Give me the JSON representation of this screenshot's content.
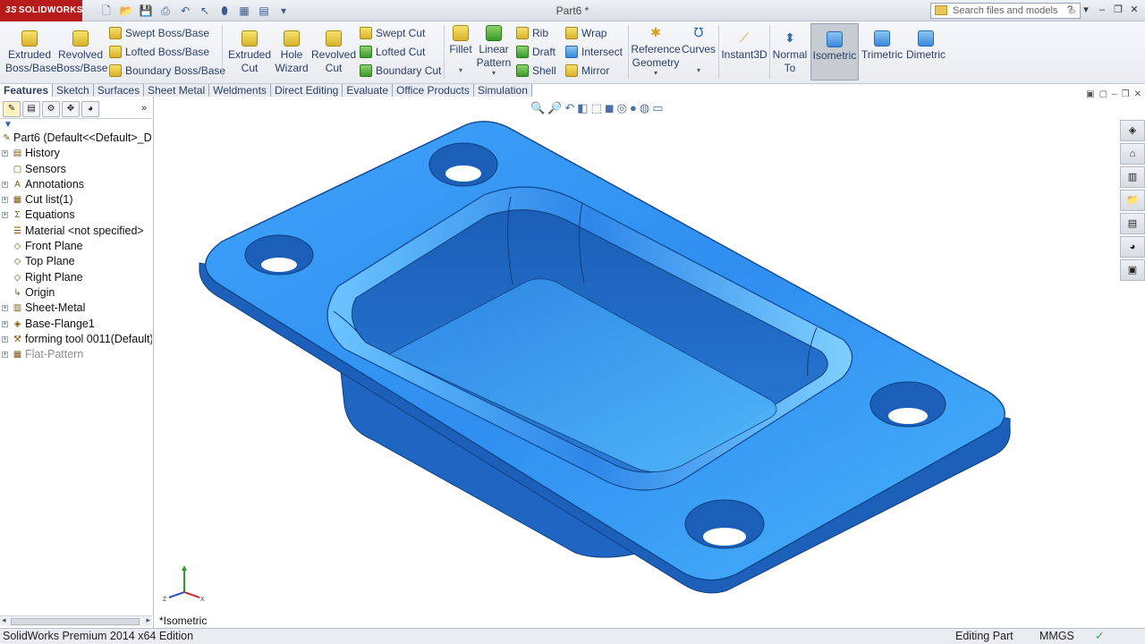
{
  "app": {
    "brand_ds": "3S",
    "brand": "SOLIDWORKS",
    "document_title": "Part6 *"
  },
  "search": {
    "placeholder": "Search files and models"
  },
  "ribbon": {
    "extruded_boss": "Extruded\nBoss/Base",
    "extruded_boss_l1": "Extruded",
    "extruded_boss_l2": "Boss/Base",
    "revolved_boss_l1": "Revolved",
    "revolved_boss_l2": "Boss/Base",
    "swept_boss": "Swept Boss/Base",
    "lofted_boss": "Lofted Boss/Base",
    "boundary_boss": "Boundary Boss/Base",
    "extruded_cut_l1": "Extruded",
    "extruded_cut_l2": "Cut",
    "hole_wizard_l1": "Hole",
    "hole_wizard_l2": "Wizard",
    "revolved_cut_l1": "Revolved",
    "revolved_cut_l2": "Cut",
    "swept_cut": "Swept Cut",
    "lofted_cut": "Lofted Cut",
    "boundary_cut": "Boundary Cut",
    "fillet": "Fillet",
    "linear_pattern_l1": "Linear",
    "linear_pattern_l2": "Pattern",
    "rib": "Rib",
    "draft": "Draft",
    "shell": "Shell",
    "wrap": "Wrap",
    "intersect": "Intersect",
    "mirror": "Mirror",
    "reference_geometry_l1": "Reference",
    "reference_geometry_l2": "Geometry",
    "curves": "Curves",
    "instant3d": "Instant3D",
    "normal_to_l1": "Normal",
    "normal_to_l2": "To",
    "isometric": "Isometric",
    "trimetric": "Trimetric",
    "dimetric": "Dimetric"
  },
  "tabs": [
    "Features",
    "Sketch",
    "Surfaces",
    "Sheet Metal",
    "Weldments",
    "Direct Editing",
    "Evaluate",
    "Office Products",
    "Simulation"
  ],
  "tree": {
    "root": "Part6  (Default<<Default>_Di",
    "items": [
      {
        "label": "History",
        "expandable": true
      },
      {
        "label": "Sensors",
        "expandable": false
      },
      {
        "label": "Annotations",
        "expandable": true
      },
      {
        "label": "Cut list(1)",
        "expandable": true
      },
      {
        "label": "Equations",
        "expandable": true
      },
      {
        "label": "Material <not specified>",
        "expandable": false
      },
      {
        "label": "Front Plane",
        "expandable": false
      },
      {
        "label": "Top Plane",
        "expandable": false
      },
      {
        "label": "Right Plane",
        "expandable": false
      },
      {
        "label": "Origin",
        "expandable": false
      },
      {
        "label": "Sheet-Metal",
        "expandable": true
      },
      {
        "label": "Base-Flange1",
        "expandable": true
      },
      {
        "label": "forming tool 0011(Default)",
        "expandable": true
      },
      {
        "label": "Flat-Pattern",
        "expandable": true,
        "suppressed": true
      }
    ]
  },
  "viewport": {
    "view_label": "*Isometric"
  },
  "statusbar": {
    "edition": "SolidWorks Premium 2014 x64 Edition",
    "mode": "Editing Part",
    "units": "MMGS"
  },
  "colors": {
    "part_blue": "#2f8ef0",
    "brand_red": "#b81b1b"
  }
}
